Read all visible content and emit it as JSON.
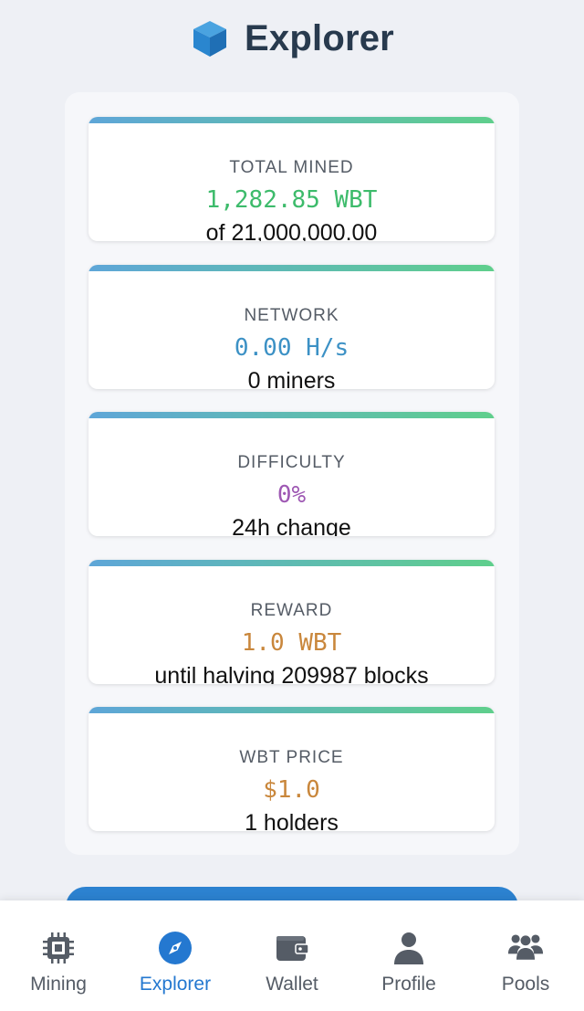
{
  "header": {
    "title": "Explorer",
    "icon": "cube-icon"
  },
  "colors": {
    "accent": "#2478d0",
    "mined": "#3dbb6b",
    "network": "#3c91c5",
    "difficulty": "#9e58b3",
    "reward": "#c9873c",
    "price": "#c9873c"
  },
  "stats": [
    {
      "name": "total-mined",
      "label": "TOTAL MINED",
      "value": "1,282.85 WBT",
      "sub": "of 21,000,000.00"
    },
    {
      "name": "network",
      "label": "NETWORK",
      "value": "0.00 H/s",
      "sub": "0 miners"
    },
    {
      "name": "difficulty",
      "label": "DIFFICULTY",
      "value": "0%",
      "sub": "24h change"
    },
    {
      "name": "reward",
      "label": "REWARD",
      "value": "1.0 WBT",
      "sub": "until halving 209987 blocks"
    },
    {
      "name": "wbt-price",
      "label": "WBT PRICE",
      "value": "$1.0",
      "sub": "1 holders"
    }
  ],
  "nav": [
    {
      "label": "Mining",
      "icon": "chip-icon",
      "active": false
    },
    {
      "label": "Explorer",
      "icon": "compass-icon",
      "active": true
    },
    {
      "label": "Wallet",
      "icon": "wallet-icon",
      "active": false
    },
    {
      "label": "Profile",
      "icon": "user-icon",
      "active": false
    },
    {
      "label": "Pools",
      "icon": "users-icon",
      "active": false
    }
  ]
}
